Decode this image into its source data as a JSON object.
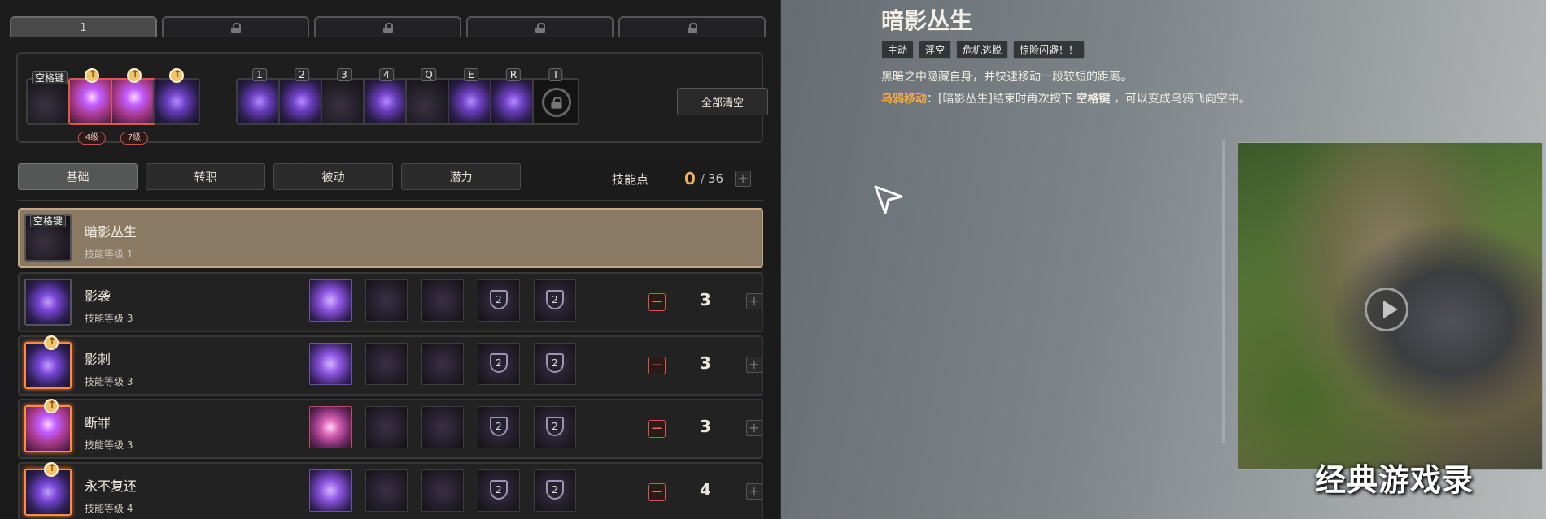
{
  "loadout_tabs": [
    {
      "label": "1",
      "active": true
    },
    {
      "label": "",
      "locked": true
    },
    {
      "label": "",
      "locked": true
    },
    {
      "label": "",
      "locked": true
    },
    {
      "label": "",
      "locked": true
    }
  ],
  "hotbar": {
    "slots": [
      {
        "key": "空格键",
        "style": "dark",
        "icon": "shadow-figure-icon"
      },
      {
        "key": "",
        "unlock": true,
        "level_badge": "4级",
        "style": "red",
        "icon": "shadow-stab-icon"
      },
      {
        "key": "",
        "unlock": true,
        "level_badge": "7级",
        "style": "red",
        "icon": "judgement-icon"
      },
      {
        "key": "",
        "unlock": true,
        "style": "purple",
        "icon": "never-return-icon"
      },
      {
        "key": "1",
        "style": "purple",
        "icon": "crow-icon"
      },
      {
        "key": "2",
        "style": "purple",
        "icon": "burst-icon"
      },
      {
        "key": "3",
        "style": "dark",
        "icon": "shadow-beast-icon"
      },
      {
        "key": "4",
        "style": "purple",
        "icon": "star-sigil-icon"
      },
      {
        "key": "Q",
        "style": "dark",
        "icon": "blade-icon"
      },
      {
        "key": "E",
        "style": "purple",
        "icon": "claw-icon"
      },
      {
        "key": "R",
        "style": "purple",
        "icon": "swarm-icon"
      },
      {
        "key": "T",
        "style": "locked",
        "icon": "padlock-icon"
      }
    ],
    "clear_all_label": "全部清空"
  },
  "category_tabs": [
    "基础",
    "转职",
    "被动",
    "潜力"
  ],
  "skill_points": {
    "label": "技能点",
    "current": "0",
    "separator": "/",
    "total": "36",
    "plus": "+"
  },
  "skills": [
    {
      "name": "暗影丛生",
      "level": "技能等级 1",
      "key": "空格键",
      "selected": true,
      "icon_style": "dark"
    },
    {
      "name": "影袭",
      "level": "技能等级 3",
      "value": "3",
      "icon_style": "purple",
      "upgrades": [
        {
          "active": true
        },
        {},
        {},
        {
          "tier": "2"
        },
        {
          "tier": "2"
        }
      ]
    },
    {
      "name": "影刺",
      "level": "技能等级 3",
      "value": "3",
      "icon_style": "purple",
      "unlock": true,
      "upgrades": [
        {
          "active": true
        },
        {},
        {},
        {
          "tier": "2"
        },
        {
          "tier": "2"
        }
      ]
    },
    {
      "name": "断罪",
      "level": "技能等级 3",
      "value": "3",
      "icon_style": "red",
      "unlock": true,
      "upgrades": [
        {
          "active": true,
          "red": true
        },
        {},
        {},
        {
          "tier": "2"
        },
        {
          "tier": "2"
        }
      ]
    },
    {
      "name": "永不复还",
      "level": "技能等级 4",
      "value": "4",
      "icon_style": "purple",
      "unlock": true,
      "upgrades": [
        {
          "active": true
        },
        {},
        {},
        {
          "tier": "2"
        },
        {
          "tier": "2"
        }
      ]
    }
  ],
  "detail": {
    "title": "暗影丛生",
    "tags": [
      "主动",
      "浮空",
      "危机逃脱",
      "惊险闪避！！"
    ],
    "description": "黑暗之中隐藏自身，并快速移动一段较短的距离。",
    "extra_label": "乌鸦移动",
    "extra_colon": "：",
    "extra_skill_ref": "[暗影丛生]",
    "extra_mid": "结束时再次按下",
    "extra_key": "空格键",
    "extra_end": "，可以变成乌鸦飞向空中。"
  },
  "watermark": "经典游戏录",
  "colors": {
    "accent_orange": "#f0b15a",
    "selected_row": "#8a7a64",
    "minus_red": "#f06a55"
  }
}
